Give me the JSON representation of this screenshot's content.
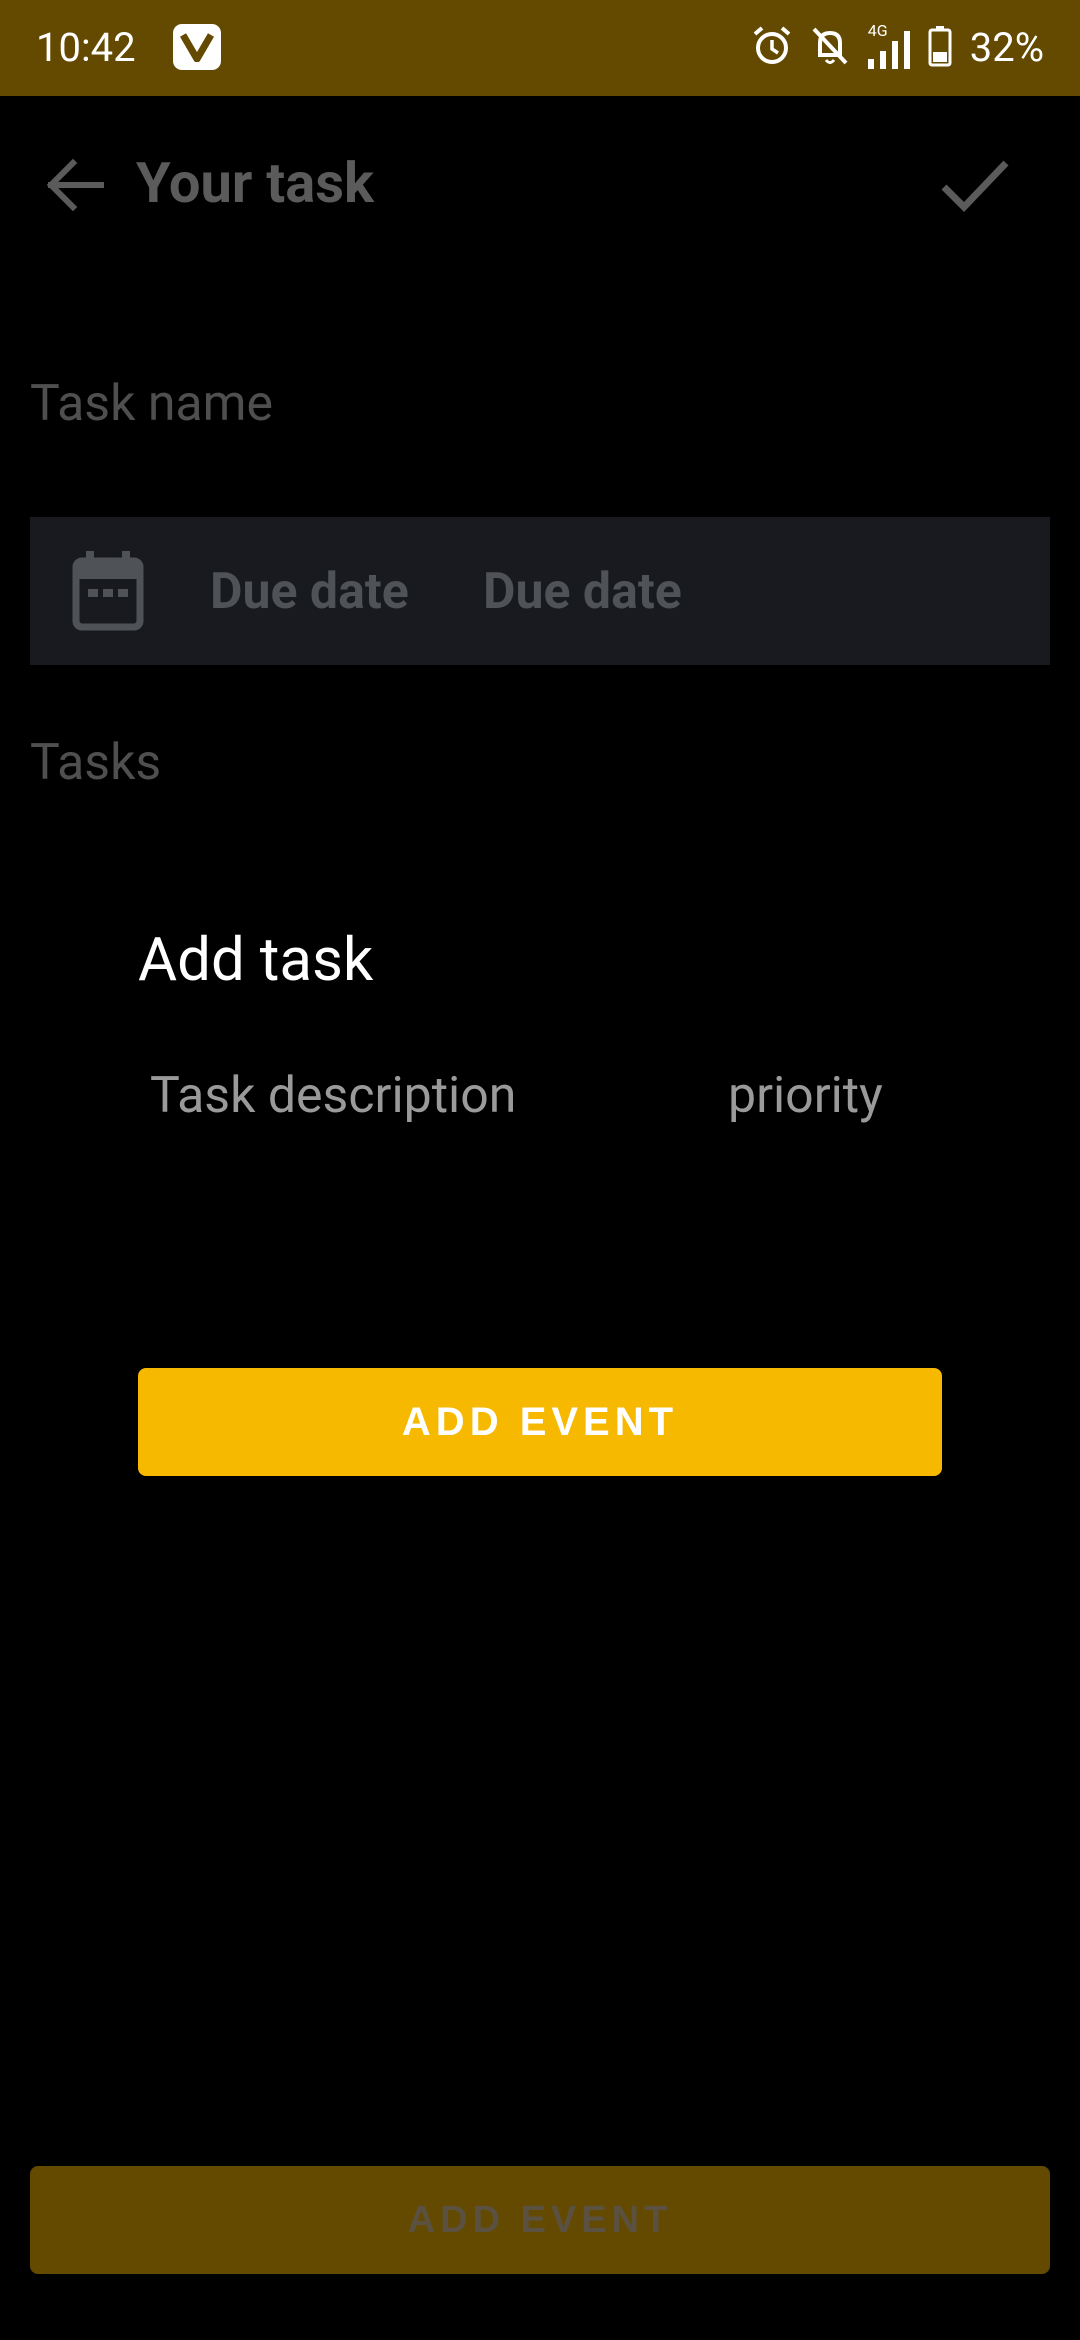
{
  "status_bar": {
    "time": "10:42",
    "battery_percent": "32%",
    "network_label": "4G",
    "icons": [
      "app-v-icon",
      "alarm-icon",
      "bell-off-icon",
      "signal-icon",
      "battery-icon"
    ]
  },
  "toolbar": {
    "title": "Your task",
    "back_icon": "arrow-back-icon",
    "confirm_icon": "check-icon"
  },
  "form": {
    "task_name_placeholder": "Task name",
    "due_date_label_1": "Due date",
    "due_date_label_2": "Due date",
    "calendar_icon": "calendar-icon",
    "tasks_label": "Tasks",
    "bottom_button_label": "ADD EVENT"
  },
  "dialog": {
    "title": "Add task",
    "description_placeholder": "Task description",
    "priority_placeholder": "priority",
    "button_label": "ADD EVENT"
  },
  "colors": {
    "status_bar_bg": "#644a00",
    "accent": "#f7b900",
    "background": "#000000",
    "due_row_bg": "#181a1f"
  }
}
